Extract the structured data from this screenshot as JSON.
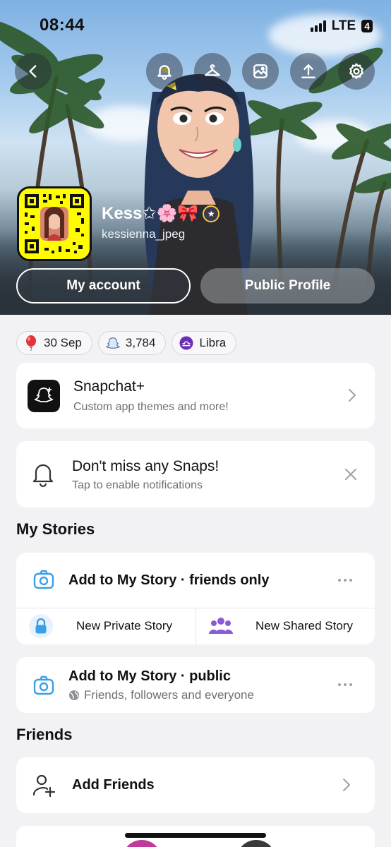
{
  "status_bar": {
    "time": "08:44",
    "network": "LTE",
    "battery": "4"
  },
  "header": {
    "icons": [
      "back-icon",
      "bell-icon",
      "hanger-icon",
      "image-icon",
      "share-icon",
      "gear-icon"
    ],
    "display_name": "Kess✩🌸🎀",
    "username": "kessienna_jpeg",
    "buttons": {
      "my_account": "My account",
      "public_profile": "Public Profile"
    }
  },
  "chips": [
    {
      "icon": "balloon-icon",
      "label": "30 Sep"
    },
    {
      "icon": "snap-friends-icon",
      "label": "3,784"
    },
    {
      "icon": "libra-icon",
      "label": "Libra"
    }
  ],
  "snapchat_plus": {
    "title": "Snapchat+",
    "subtitle": "Custom app themes and more!"
  },
  "notifications": {
    "title": "Don't miss any Snaps!",
    "subtitle": "Tap to enable notifications"
  },
  "my_stories": {
    "heading": "My Stories",
    "friends_only": "Add to My Story · friends only",
    "new_private": "New Private Story",
    "new_shared": "New Shared Story",
    "public_title": "Add to My Story · public",
    "public_sub": "Friends, followers and everyone"
  },
  "friends": {
    "heading": "Friends",
    "add_friends": "Add Friends"
  },
  "colors": {
    "snap_yellow": "#fffc00",
    "accent_blue": "#3aa0e6",
    "libra_purple": "#6b2fb3",
    "shared_purple": "#8a5ad6"
  }
}
